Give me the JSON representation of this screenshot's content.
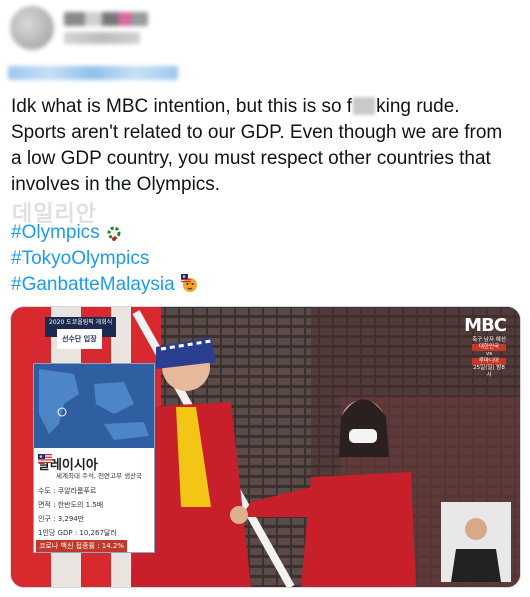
{
  "tweet": {
    "text_part1": "Idk what is MBC intention, but this is so f",
    "text_part2": "king rude. Sports aren't related to our GDP. Even though we are from a low GDP country, you must respect other countries that involves in the Olympics.",
    "hashtags": [
      "#Olympics",
      "#TokyoOlympics",
      "#GanbatteMalaysia"
    ],
    "watermark": "데일리안"
  },
  "media": {
    "banner_small": "2020 도쿄올림픽 개회식",
    "banner_main": "선수단 입장",
    "broadcaster_logo": "MBC",
    "game_info": [
      "축구 남자 예선",
      "대한민국",
      "vs",
      "루마니아",
      "25일(일) 밤8시"
    ],
    "infobox": {
      "country": "말레이시아",
      "subtitle": "세계최대 주석, 천연고무 생산국",
      "rows": [
        {
          "label": "수도 : 쿠알라룸푸르"
        },
        {
          "label": "면적 : 한반도의 1.5배"
        },
        {
          "label": "인구 : 3,294만"
        },
        {
          "label": "1인당 GDP : 10,267달러"
        }
      ],
      "highlight": "코로나 백신 접종률 : 14.2%"
    }
  },
  "colors": {
    "link": "#1d9bf0",
    "text": "#0f1419",
    "jacket_red": "#c8202a",
    "stadium": "#4a3a3a"
  },
  "icons": [
    "more-icon",
    "laurel-emoji",
    "tiger-emoji",
    "flag-malaysia-icon"
  ]
}
